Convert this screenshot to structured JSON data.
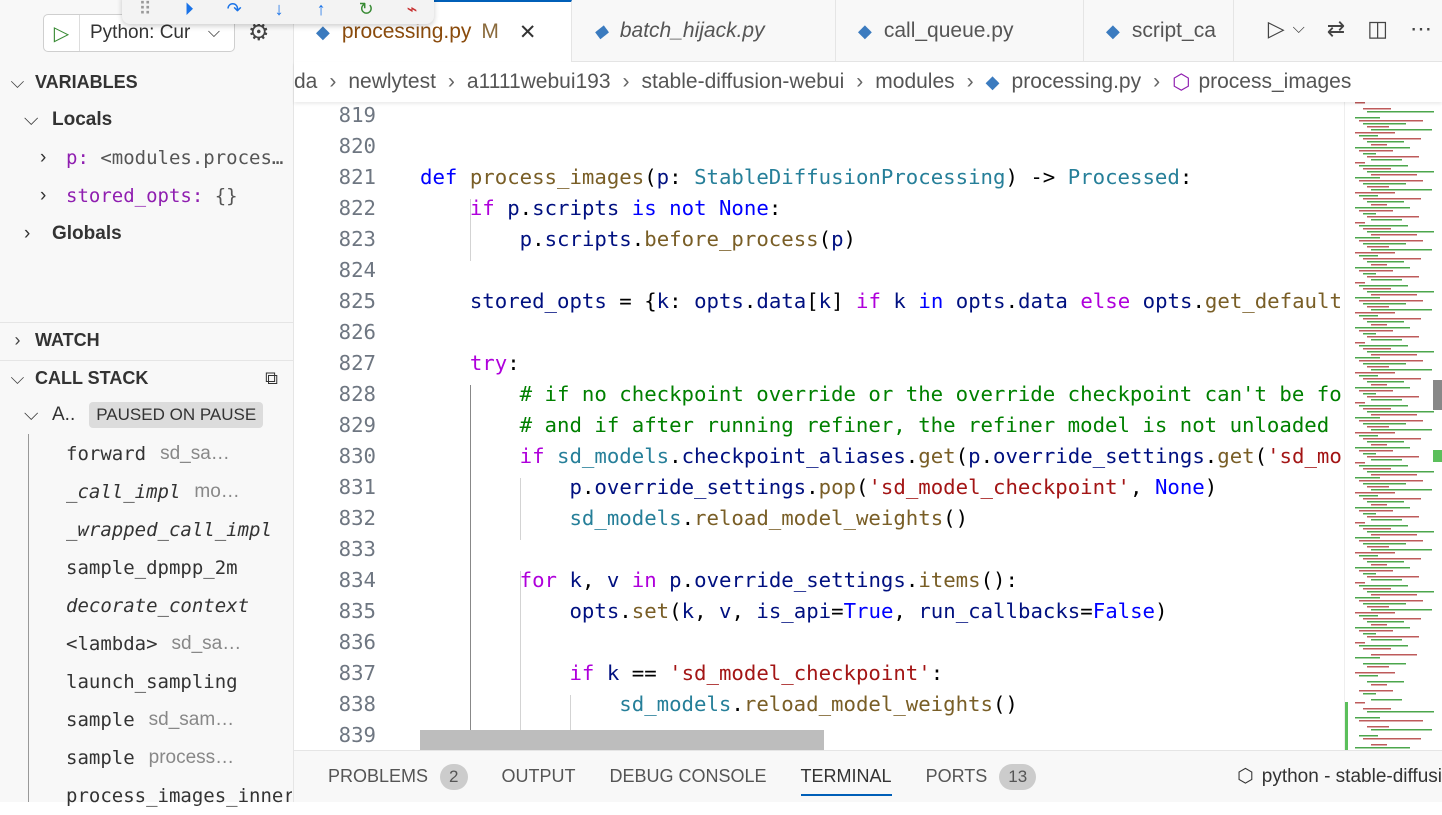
{
  "debug_toolbar": {
    "icons": [
      "drag-handle",
      "continue",
      "step-over",
      "step-into",
      "step-out",
      "restart",
      "disconnect"
    ]
  },
  "sidebar": {
    "run_config": "Python: Cur",
    "variables_title": "VARIABLES",
    "locals_label": "Locals",
    "locals": [
      {
        "name": "p:",
        "value": "<modules.proces…"
      },
      {
        "name": "stored_opts:",
        "value": "{}"
      }
    ],
    "globals_label": "Globals",
    "watch_title": "WATCH",
    "call_stack_title": "CALL STACK",
    "thread_label": "A..",
    "thread_status": "PAUSED ON PAUSE",
    "frames": [
      {
        "name": "forward",
        "source": "sd_sa…",
        "italic": false
      },
      {
        "name": "_call_impl",
        "source": "mo…",
        "italic": true
      },
      {
        "name": "_wrapped_call_impl",
        "source": "",
        "italic": true
      },
      {
        "name": "sample_dpmpp_2m",
        "source": "",
        "italic": false
      },
      {
        "name": "decorate_context",
        "source": "",
        "italic": true
      },
      {
        "name": "<lambda>",
        "source": "sd_sa…",
        "italic": false
      },
      {
        "name": "launch_sampling",
        "source": "",
        "italic": false
      },
      {
        "name": "sample",
        "source": "sd_sam…",
        "italic": false
      },
      {
        "name": "sample",
        "source": "process…",
        "italic": false
      },
      {
        "name": "process_images_inner",
        "source": "",
        "italic": false
      }
    ]
  },
  "tabs": [
    {
      "label": "processing.py",
      "badge": "M",
      "active": true
    },
    {
      "label": "batch_hijack.py",
      "active": false
    },
    {
      "label": "call_queue.py",
      "active": false
    },
    {
      "label": "script_ca",
      "active": false
    }
  ],
  "breadcrumb": [
    "da",
    "newlytest",
    "a1111webui193",
    "stable-diffusion-webui",
    "modules",
    "processing.py",
    "process_images"
  ],
  "code": [
    {
      "n": "819",
      "t": []
    },
    {
      "n": "820",
      "t": []
    },
    {
      "n": "821",
      "t": [
        [
          "d",
          "def "
        ],
        [
          "f",
          "process_images"
        ],
        [
          "",
          "("
        ],
        [
          "v",
          "p"
        ],
        [
          "",
          ": "
        ],
        [
          "c",
          "StableDiffusionProcessing"
        ],
        [
          "",
          ") -> "
        ],
        [
          "c",
          "Processed"
        ],
        [
          "",
          ":"
        ]
      ]
    },
    {
      "n": "822",
      "t": [
        [
          "",
          "    "
        ],
        [
          "k",
          "if "
        ],
        [
          "v",
          "p"
        ],
        [
          "",
          "."
        ],
        [
          "v",
          "scripts"
        ],
        [
          "",
          " "
        ],
        [
          "d",
          "is not None"
        ],
        [
          "",
          ":"
        ]
      ]
    },
    {
      "n": "823",
      "t": [
        [
          "",
          "        "
        ],
        [
          "v",
          "p"
        ],
        [
          "",
          "."
        ],
        [
          "v",
          "scripts"
        ],
        [
          "",
          "."
        ],
        [
          "f",
          "before_process"
        ],
        [
          "",
          "("
        ],
        [
          "v",
          "p"
        ],
        [
          "",
          ")"
        ]
      ]
    },
    {
      "n": "824",
      "t": []
    },
    {
      "n": "825",
      "t": [
        [
          "",
          "    "
        ],
        [
          "v",
          "stored_opts"
        ],
        [
          "",
          " = {"
        ],
        [
          "v",
          "k"
        ],
        [
          "",
          ": "
        ],
        [
          "v",
          "opts"
        ],
        [
          "",
          "."
        ],
        [
          "v",
          "data"
        ],
        [
          "",
          "["
        ],
        [
          "v",
          "k"
        ],
        [
          "",
          "] "
        ],
        [
          "k",
          "if "
        ],
        [
          "v",
          "k"
        ],
        [
          "",
          " "
        ],
        [
          "d",
          "in "
        ],
        [
          "v",
          "opts"
        ],
        [
          "",
          "."
        ],
        [
          "v",
          "data"
        ],
        [
          "",
          " "
        ],
        [
          "k",
          "else "
        ],
        [
          "v",
          "opts"
        ],
        [
          "",
          "."
        ],
        [
          "f",
          "get_default"
        ]
      ]
    },
    {
      "n": "826",
      "t": []
    },
    {
      "n": "827",
      "t": [
        [
          "",
          "    "
        ],
        [
          "k",
          "try"
        ],
        [
          "",
          ":"
        ]
      ]
    },
    {
      "n": "828",
      "t": [
        [
          "",
          "        "
        ],
        [
          "g",
          "# if no checkpoint override or the override checkpoint can't be fo"
        ]
      ]
    },
    {
      "n": "829",
      "t": [
        [
          "",
          "        "
        ],
        [
          "g",
          "# and if after running refiner, the refiner model is not unloaded"
        ]
      ]
    },
    {
      "n": "830",
      "t": [
        [
          "",
          "        "
        ],
        [
          "k",
          "if "
        ],
        [
          "c",
          "sd_models"
        ],
        [
          "",
          "."
        ],
        [
          "v",
          "checkpoint_aliases"
        ],
        [
          "",
          "."
        ],
        [
          "f",
          "get"
        ],
        [
          "",
          "("
        ],
        [
          "v",
          "p"
        ],
        [
          "",
          "."
        ],
        [
          "v",
          "override_settings"
        ],
        [
          "",
          "."
        ],
        [
          "f",
          "get"
        ],
        [
          "",
          "("
        ],
        [
          "s",
          "'sd_mo"
        ]
      ]
    },
    {
      "n": "831",
      "t": [
        [
          "",
          "            "
        ],
        [
          "v",
          "p"
        ],
        [
          "",
          "."
        ],
        [
          "v",
          "override_settings"
        ],
        [
          "",
          "."
        ],
        [
          "f",
          "pop"
        ],
        [
          "",
          "("
        ],
        [
          "s",
          "'sd_model_checkpoint'"
        ],
        [
          "",
          ", "
        ],
        [
          "d",
          "None"
        ],
        [
          "",
          ")"
        ]
      ]
    },
    {
      "n": "832",
      "t": [
        [
          "",
          "            "
        ],
        [
          "c",
          "sd_models"
        ],
        [
          "",
          "."
        ],
        [
          "f",
          "reload_model_weights"
        ],
        [
          "",
          "()"
        ]
      ]
    },
    {
      "n": "833",
      "t": []
    },
    {
      "n": "834",
      "t": [
        [
          "",
          "        "
        ],
        [
          "k",
          "for "
        ],
        [
          "v",
          "k"
        ],
        [
          "",
          ", "
        ],
        [
          "v",
          "v"
        ],
        [
          "",
          " "
        ],
        [
          "k",
          "in "
        ],
        [
          "v",
          "p"
        ],
        [
          "",
          "."
        ],
        [
          "v",
          "override_settings"
        ],
        [
          "",
          "."
        ],
        [
          "f",
          "items"
        ],
        [
          "",
          "():"
        ]
      ]
    },
    {
      "n": "835",
      "t": [
        [
          "",
          "            "
        ],
        [
          "v",
          "opts"
        ],
        [
          "",
          "."
        ],
        [
          "f",
          "set"
        ],
        [
          "",
          "("
        ],
        [
          "v",
          "k"
        ],
        [
          "",
          ", "
        ],
        [
          "v",
          "v"
        ],
        [
          "",
          ", "
        ],
        [
          "v",
          "is_api"
        ],
        [
          "",
          "="
        ],
        [
          "d",
          "True"
        ],
        [
          "",
          ", "
        ],
        [
          "v",
          "run_callbacks"
        ],
        [
          "",
          "="
        ],
        [
          "d",
          "False"
        ],
        [
          "",
          ")"
        ]
      ]
    },
    {
      "n": "836",
      "t": []
    },
    {
      "n": "837",
      "t": [
        [
          "",
          "            "
        ],
        [
          "k",
          "if "
        ],
        [
          "v",
          "k"
        ],
        [
          "",
          " == "
        ],
        [
          "s",
          "'sd_model_checkpoint'"
        ],
        [
          "",
          ":"
        ]
      ]
    },
    {
      "n": "838",
      "t": [
        [
          "",
          "                "
        ],
        [
          "c",
          "sd_models"
        ],
        [
          "",
          "."
        ],
        [
          "f",
          "reload_model_weights"
        ],
        [
          "",
          "()"
        ]
      ]
    },
    {
      "n": "839",
      "t": []
    }
  ],
  "panel": {
    "tabs": [
      {
        "label": "PROBLEMS",
        "count": "2"
      },
      {
        "label": "OUTPUT"
      },
      {
        "label": "DEBUG CONSOLE"
      },
      {
        "label": "TERMINAL",
        "active": true
      },
      {
        "label": "PORTS",
        "count": "13"
      }
    ],
    "terminal_label": "python - stable-diffusi"
  }
}
